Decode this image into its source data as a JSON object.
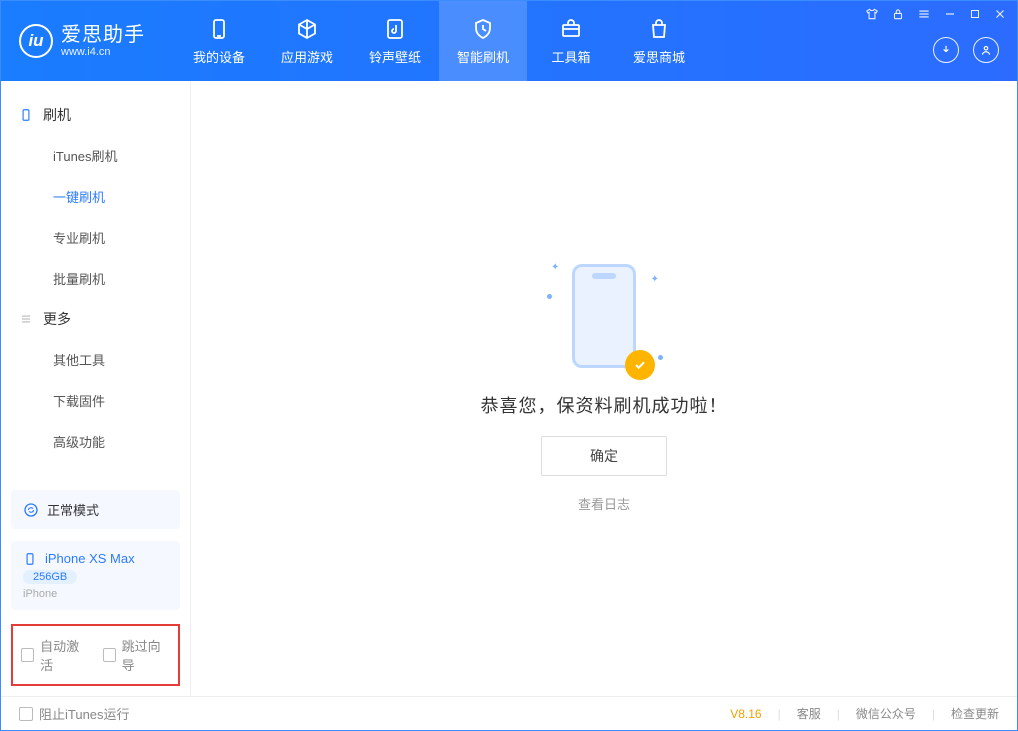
{
  "app": {
    "name": "爱思助手",
    "url": "www.i4.cn"
  },
  "tabs": [
    {
      "label": "我的设备",
      "icon": "device-icon"
    },
    {
      "label": "应用游戏",
      "icon": "cube-icon"
    },
    {
      "label": "铃声壁纸",
      "icon": "music-icon"
    },
    {
      "label": "智能刷机",
      "icon": "shield-icon",
      "active": true
    },
    {
      "label": "工具箱",
      "icon": "toolbox-icon"
    },
    {
      "label": "爱思商城",
      "icon": "bag-icon"
    }
  ],
  "sidebar": {
    "group1": {
      "title": "刷机",
      "items": [
        "iTunes刷机",
        "一键刷机",
        "专业刷机",
        "批量刷机"
      ],
      "activeIndex": 1
    },
    "group2": {
      "title": "更多",
      "items": [
        "其他工具",
        "下载固件",
        "高级功能"
      ]
    }
  },
  "device": {
    "mode": "正常模式",
    "name": "iPhone XS Max",
    "storage": "256GB",
    "type": "iPhone"
  },
  "options": {
    "auto_activate": "自动激活",
    "skip_guide": "跳过向导"
  },
  "main": {
    "success_text": "恭喜您，保资料刷机成功啦！",
    "ok_button": "确定",
    "view_log": "查看日志"
  },
  "footer": {
    "block_itunes": "阻止iTunes运行",
    "version": "V8.16",
    "links": [
      "客服",
      "微信公众号",
      "检查更新"
    ]
  }
}
